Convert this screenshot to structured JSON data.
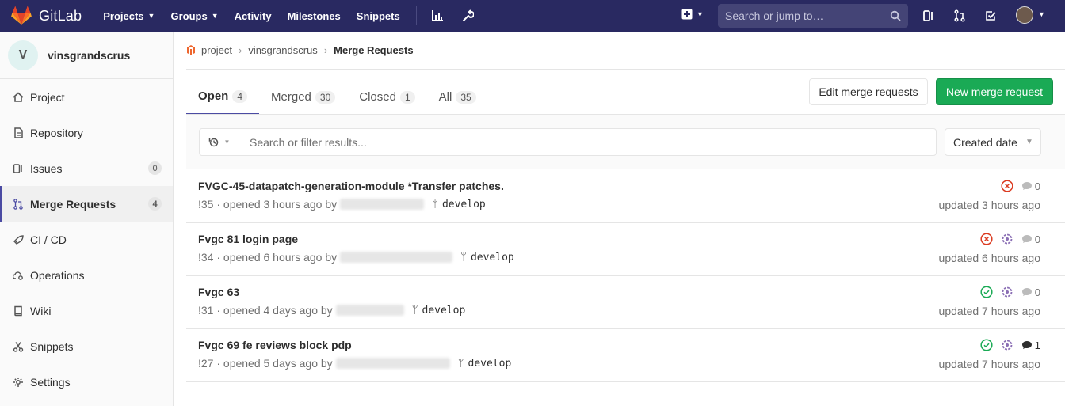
{
  "topbar": {
    "brand": "GitLab",
    "nav": [
      {
        "label": "Projects",
        "dropdown": true
      },
      {
        "label": "Groups",
        "dropdown": true
      },
      {
        "label": "Activity",
        "dropdown": false
      },
      {
        "label": "Milestones",
        "dropdown": false
      },
      {
        "label": "Snippets",
        "dropdown": false
      }
    ],
    "search_placeholder": "Search or jump to…",
    "brand_color": "#292961"
  },
  "sidebar": {
    "project_initial": "V",
    "project_name": "vinsgrandscrus",
    "items": [
      {
        "label": "Project",
        "icon": "home-icon",
        "count": ""
      },
      {
        "label": "Repository",
        "icon": "doc-icon",
        "count": ""
      },
      {
        "label": "Issues",
        "icon": "issues-icon",
        "count": "0"
      },
      {
        "label": "Merge Requests",
        "icon": "merge-request-icon",
        "count": "4"
      },
      {
        "label": "CI / CD",
        "icon": "rocket-icon",
        "count": ""
      },
      {
        "label": "Operations",
        "icon": "cloud-gear-icon",
        "count": ""
      },
      {
        "label": "Wiki",
        "icon": "book-icon",
        "count": ""
      },
      {
        "label": "Snippets",
        "icon": "scissors-icon",
        "count": ""
      },
      {
        "label": "Settings",
        "icon": "gear-icon",
        "count": ""
      }
    ]
  },
  "breadcrumb": {
    "items": [
      "project",
      "vinsgrandscrus",
      "Merge Requests"
    ]
  },
  "tabs": [
    {
      "label": "Open",
      "count": "4"
    },
    {
      "label": "Merged",
      "count": "30"
    },
    {
      "label": "Closed",
      "count": "1"
    },
    {
      "label": "All",
      "count": "35"
    }
  ],
  "buttons": {
    "edit": "Edit merge requests",
    "new": "New merge request"
  },
  "filter": {
    "placeholder": "Search or filter results...",
    "sort": "Created date"
  },
  "merge_requests": [
    {
      "title": "FVGC-45-datapatch-generation-module *Transfer patches.",
      "meta": "!35 · opened 3 hours ago by",
      "branch": "develop",
      "pipeline": "failed",
      "approval": false,
      "comments": "0",
      "updated": "updated 3 hours ago"
    },
    {
      "title": "Fvgc 81 login page",
      "meta": "!34 · opened 6 hours ago by",
      "branch": "develop",
      "pipeline": "failed",
      "approval": true,
      "comments": "0",
      "updated": "updated 6 hours ago"
    },
    {
      "title": "Fvgc 63",
      "meta": "!31 · opened 4 days ago by",
      "branch": "develop",
      "pipeline": "passed",
      "approval": true,
      "comments": "0",
      "updated": "updated 7 hours ago"
    },
    {
      "title": "Fvgc 69 fe reviews block pdp",
      "meta": "!27 · opened 5 days ago by",
      "branch": "develop",
      "pipeline": "passed",
      "approval": true,
      "comments": "1",
      "updated": "updated 7 hours ago"
    }
  ]
}
